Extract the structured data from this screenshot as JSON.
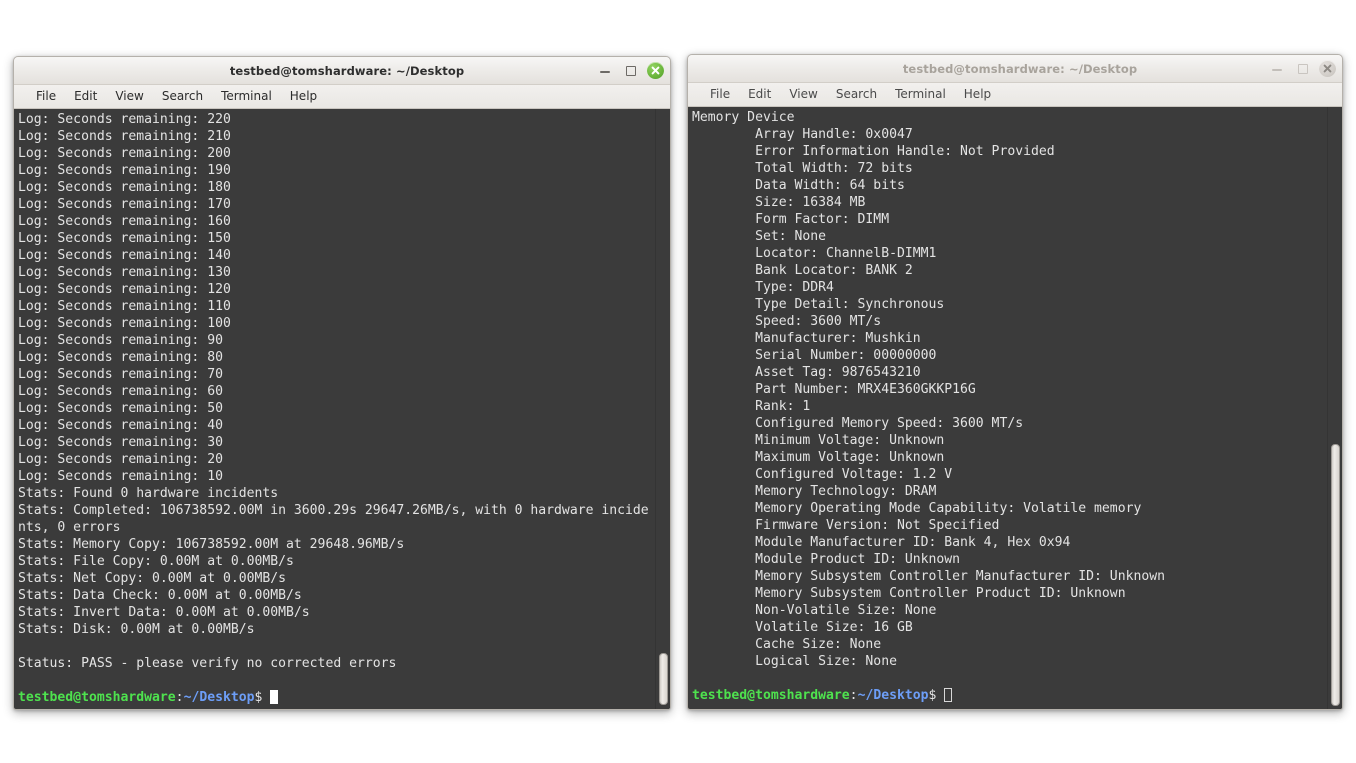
{
  "desktop": {
    "background": "#ffffff"
  },
  "windows": [
    {
      "id": "left",
      "title": "testbed@tomshardware: ~/Desktop",
      "focused": true,
      "menu": [
        "File",
        "Edit",
        "View",
        "Search",
        "Terminal",
        "Help"
      ],
      "controls": {
        "minimize": "minimize",
        "maximize": "maximize",
        "close": "close"
      },
      "colors": {
        "close_button": "#6eb83e",
        "background": "#3b3b3b",
        "foreground": "#e3e3e3"
      },
      "lines": [
        "Log: Seconds remaining: 220",
        "Log: Seconds remaining: 210",
        "Log: Seconds remaining: 200",
        "Log: Seconds remaining: 190",
        "Log: Seconds remaining: 180",
        "Log: Seconds remaining: 170",
        "Log: Seconds remaining: 160",
        "Log: Seconds remaining: 150",
        "Log: Seconds remaining: 140",
        "Log: Seconds remaining: 130",
        "Log: Seconds remaining: 120",
        "Log: Seconds remaining: 110",
        "Log: Seconds remaining: 100",
        "Log: Seconds remaining: 90",
        "Log: Seconds remaining: 80",
        "Log: Seconds remaining: 70",
        "Log: Seconds remaining: 60",
        "Log: Seconds remaining: 50",
        "Log: Seconds remaining: 40",
        "Log: Seconds remaining: 30",
        "Log: Seconds remaining: 20",
        "Log: Seconds remaining: 10",
        "Stats: Found 0 hardware incidents",
        "Stats: Completed: 106738592.00M in 3600.29s 29647.26MB/s, with 0 hardware incide",
        "nts, 0 errors",
        "Stats: Memory Copy: 106738592.00M at 29648.96MB/s",
        "Stats: File Copy: 0.00M at 0.00MB/s",
        "Stats: Net Copy: 0.00M at 0.00MB/s",
        "Stats: Data Check: 0.00M at 0.00MB/s",
        "Stats: Invert Data: 0.00M at 0.00MB/s",
        "Stats: Disk: 0.00M at 0.00MB/s",
        "",
        "Status: PASS - please verify no corrected errors",
        ""
      ],
      "prompt": {
        "user_host": "testbed@tomshardware",
        "separator": ":",
        "path": "~/Desktop",
        "sigil": "$",
        "cursor": "solid-block"
      }
    },
    {
      "id": "right",
      "title": "testbed@tomshardware: ~/Desktop",
      "focused": false,
      "menu": [
        "File",
        "Edit",
        "View",
        "Search",
        "Terminal",
        "Help"
      ],
      "controls": {
        "minimize": "minimize",
        "maximize": "maximize",
        "close": "close"
      },
      "colors": {
        "close_button": "#d3cfca",
        "background": "#3b3b3b",
        "foreground": "#e3e3e3"
      },
      "lines": [
        "Memory Device",
        "        Array Handle: 0x0047",
        "        Error Information Handle: Not Provided",
        "        Total Width: 72 bits",
        "        Data Width: 64 bits",
        "        Size: 16384 MB",
        "        Form Factor: DIMM",
        "        Set: None",
        "        Locator: ChannelB-DIMM1",
        "        Bank Locator: BANK 2",
        "        Type: DDR4",
        "        Type Detail: Synchronous",
        "        Speed: 3600 MT/s",
        "        Manufacturer: Mushkin",
        "        Serial Number: 00000000",
        "        Asset Tag: 9876543210",
        "        Part Number: MRX4E360GKKP16G",
        "        Rank: 1",
        "        Configured Memory Speed: 3600 MT/s",
        "        Minimum Voltage: Unknown",
        "        Maximum Voltage: Unknown",
        "        Configured Voltage: 1.2 V",
        "        Memory Technology: DRAM",
        "        Memory Operating Mode Capability: Volatile memory",
        "        Firmware Version: Not Specified",
        "        Module Manufacturer ID: Bank 4, Hex 0x94",
        "        Module Product ID: Unknown",
        "        Memory Subsystem Controller Manufacturer ID: Unknown",
        "        Memory Subsystem Controller Product ID: Unknown",
        "        Non-Volatile Size: None",
        "        Volatile Size: 16 GB",
        "        Cache Size: None",
        "        Logical Size: None",
        ""
      ],
      "prompt": {
        "user_host": "testbed@tomshardware",
        "separator": ":",
        "path": "~/Desktop",
        "sigil": "$",
        "cursor": "hollow-block"
      }
    }
  ]
}
